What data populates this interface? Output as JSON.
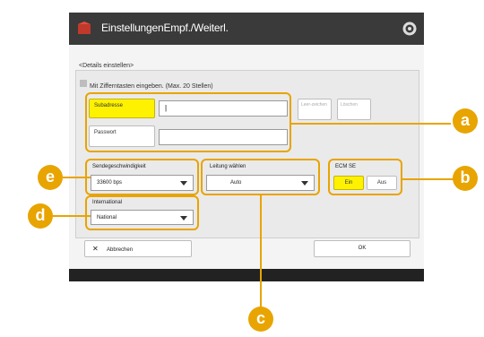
{
  "window": {
    "title": "EinstellungenEmpf./Weiterl."
  },
  "breadcrumb": "<Details einstellen>",
  "hint": "Mit Zifferntasten eingeben. (Max. 20 Stellen)",
  "fields": {
    "subaddress_label": "Subadresse",
    "subaddress_value": "|",
    "password_label": "Passwort",
    "password_value": ""
  },
  "side_buttons": {
    "btn1": "Leer-zeichen",
    "btn2": "Löschen"
  },
  "speed": {
    "label": "Sendegeschwindigkeit",
    "value": "33600 bps"
  },
  "international": {
    "label": "International",
    "value": "National"
  },
  "line": {
    "label": "Leitung wählen",
    "value": "Auto"
  },
  "ecm": {
    "label": "ECM SE",
    "on": "Ein",
    "off": "Aus"
  },
  "footer": {
    "cancel": "Abbrechen",
    "ok": "OK"
  },
  "callouts": {
    "a": "a",
    "b": "b",
    "c": "c",
    "d": "d",
    "e": "e"
  },
  "colors": {
    "accent": "#e8a400",
    "selected": "#fff200",
    "titlebar": "#3a3a3a"
  }
}
